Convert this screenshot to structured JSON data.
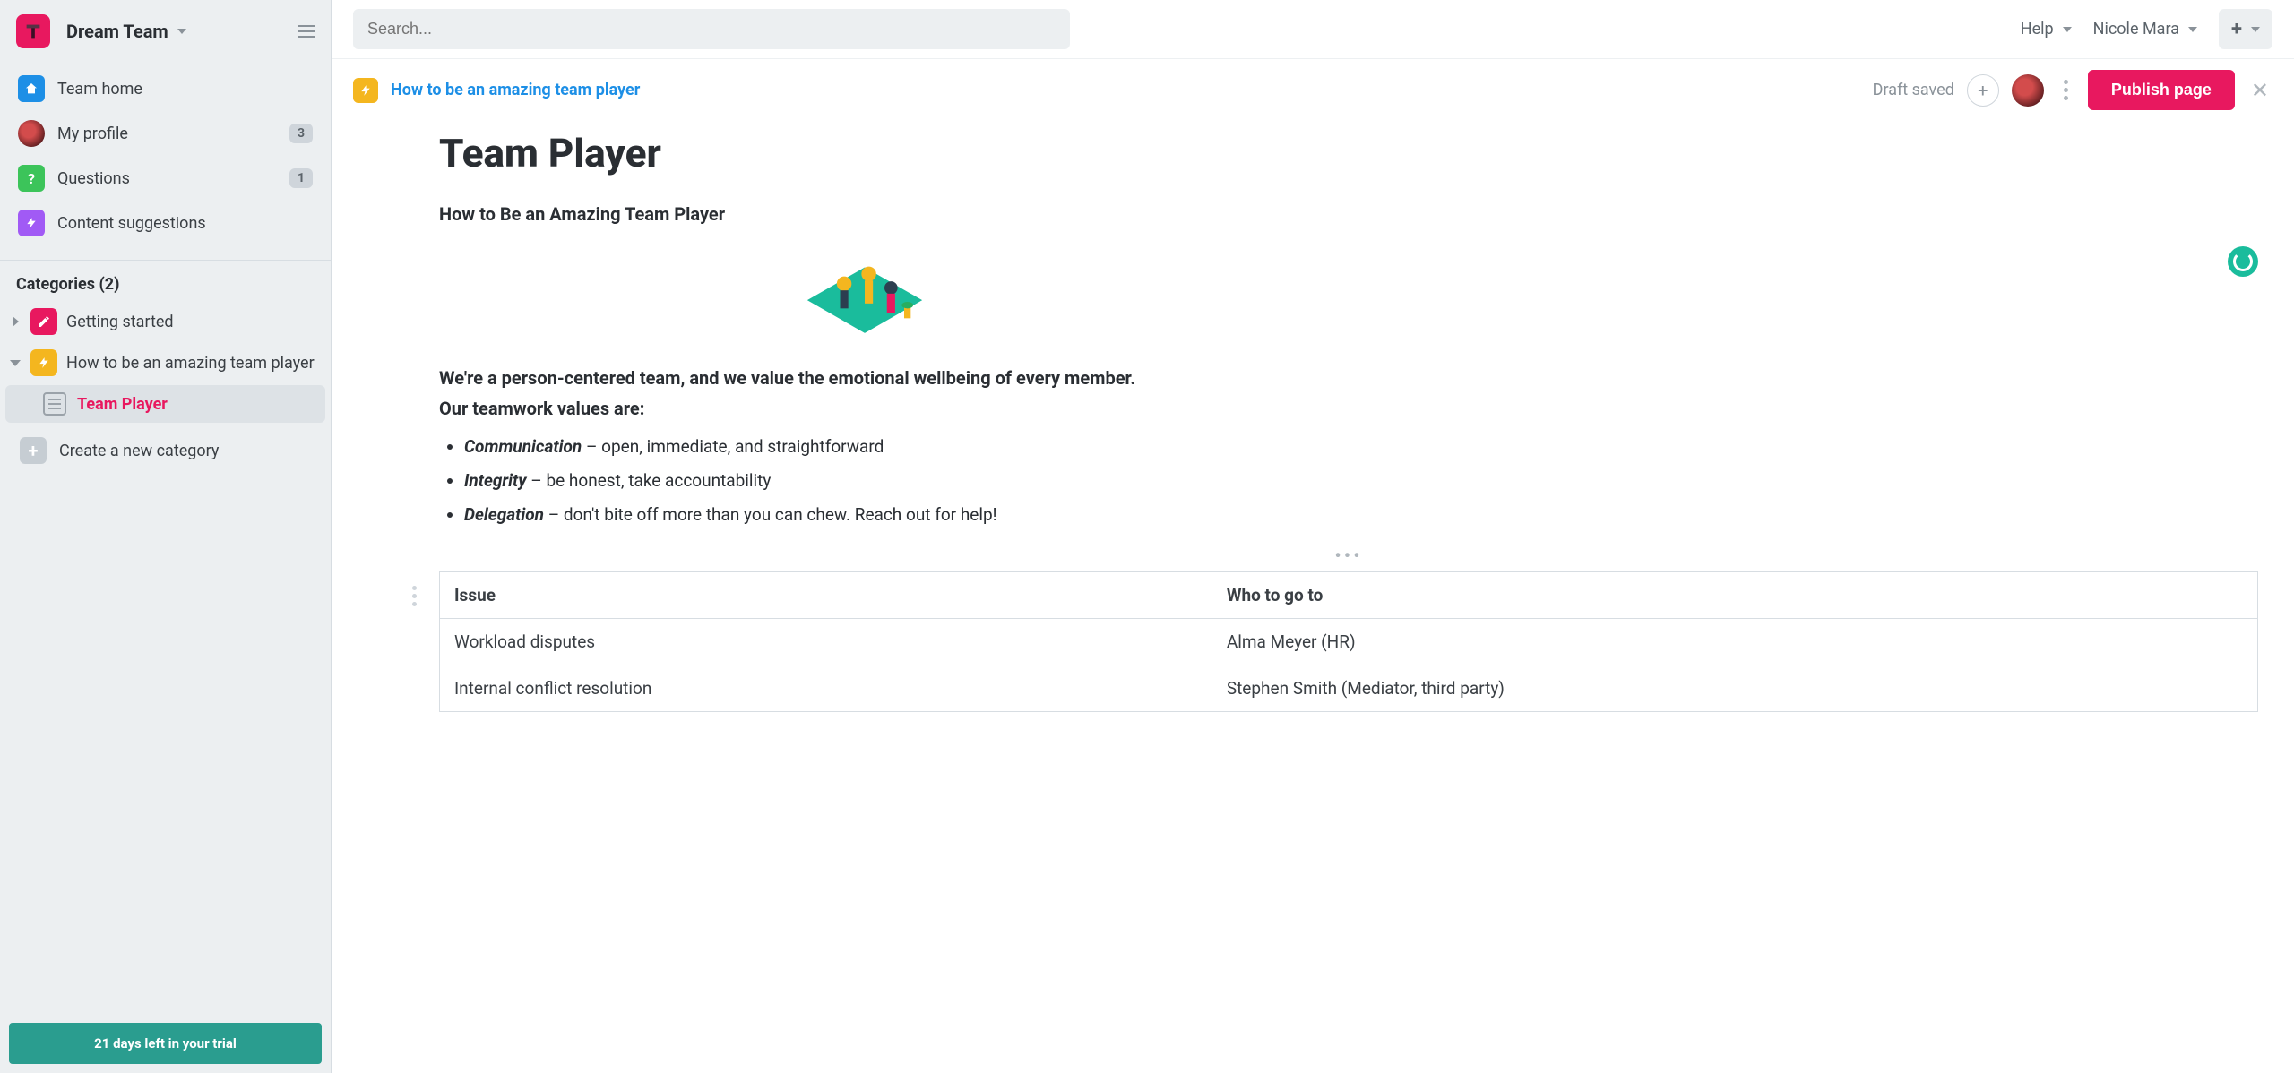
{
  "workspace": {
    "name": "Dream Team"
  },
  "search": {
    "placeholder": "Search..."
  },
  "topbar": {
    "help": "Help",
    "user": "Nicole Mara"
  },
  "sidebar": {
    "items": [
      {
        "label": "Team home",
        "icon": "home",
        "icon_bg": "#1d8fe6"
      },
      {
        "label": "My profile",
        "icon": "avatar",
        "badge": "3"
      },
      {
        "label": "Questions",
        "icon": "question",
        "icon_bg": "#3cc45a",
        "badge": "1"
      },
      {
        "label": "Content suggestions",
        "icon": "bolt",
        "icon_bg": "#a15af5"
      }
    ],
    "categories_header": "Categories (2)",
    "categories": [
      {
        "label": "Getting started",
        "icon_bg": "#e8185f",
        "expanded": false,
        "icon": "pencil"
      },
      {
        "label": "How to be an amazing team player",
        "icon_bg": "#f4b61f",
        "expanded": true,
        "icon": "bolt",
        "pages": [
          {
            "label": "Team Player",
            "active": true
          }
        ]
      }
    ],
    "create_category": "Create a new category",
    "trial_banner": "21 days left in your trial"
  },
  "page_toolbar": {
    "breadcrumb": "How to be an amazing team player",
    "status": "Draft saved",
    "publish": "Publish page"
  },
  "document": {
    "title": "Team Player",
    "subtitle": "How to Be an Amazing Team Player",
    "intro_line1": "We're a person-centered team, and we value the emotional wellbeing of every member.",
    "intro_line2": "Our teamwork values are:",
    "values": [
      {
        "keyword": "Communication",
        "rest": " – open, immediate, and straightforward"
      },
      {
        "keyword": "Integrity",
        "rest": " – be honest, take accountability"
      },
      {
        "keyword": "Delegation",
        "rest": " – don't bite off more than you can chew. Reach out for help!"
      }
    ],
    "table": {
      "headers": [
        "Issue",
        "Who to go to"
      ],
      "rows": [
        [
          "Workload disputes",
          "Alma Meyer (HR)"
        ],
        [
          "Internal conflict resolution",
          "Stephen Smith (Mediator, third party)"
        ]
      ]
    }
  }
}
